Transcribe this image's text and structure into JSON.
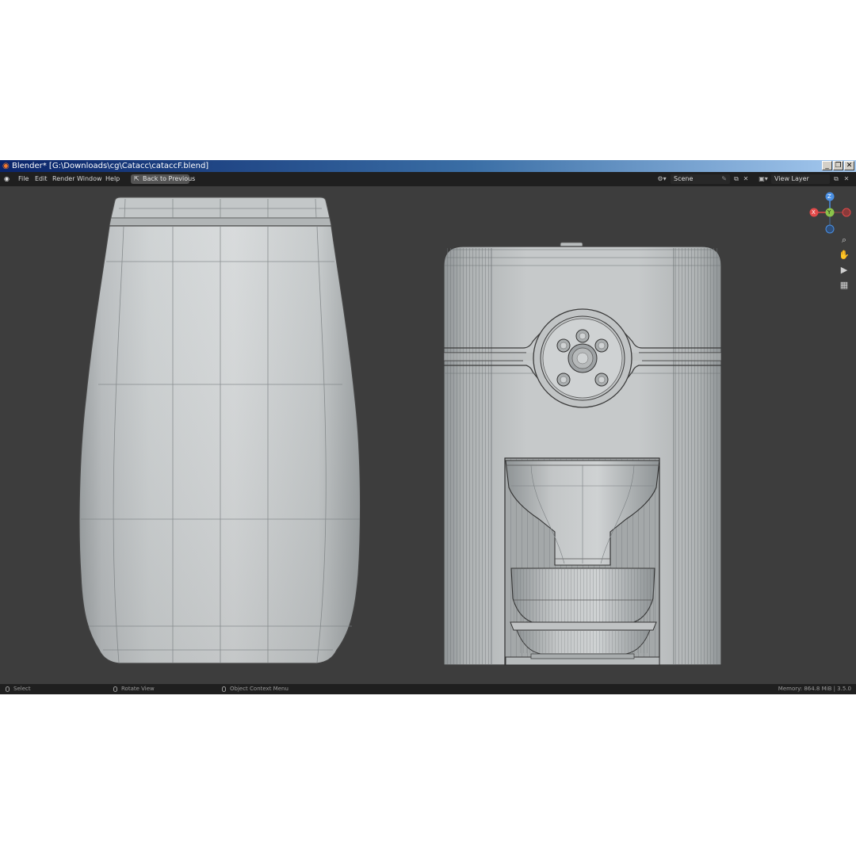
{
  "window": {
    "title": "Blender* [G:\\Downloads\\cg\\Catacc\\cataccF.blend]",
    "min_label": "_",
    "restore_label": "❐",
    "close_label": "✕"
  },
  "menu": {
    "items": [
      "File",
      "Edit",
      "Render",
      "Window",
      "Help"
    ],
    "back_label": "Back to Previous"
  },
  "scene": {
    "label": "Scene"
  },
  "view_layer": {
    "label": "View Layer"
  },
  "gizmo": {
    "z": "Z",
    "y": "Y",
    "x": "X"
  },
  "status": {
    "select": "Select",
    "rotate": "Rotate View",
    "context": "Object Context Menu",
    "memory": "Memory: 864.8 MiB | 3.5.0"
  },
  "colors": {
    "viewport": "#3d3d3d",
    "header": "#1f1f1f",
    "x_axis": "#e24a4a",
    "y_axis": "#8bc34a",
    "z_axis": "#4a8fe2"
  }
}
